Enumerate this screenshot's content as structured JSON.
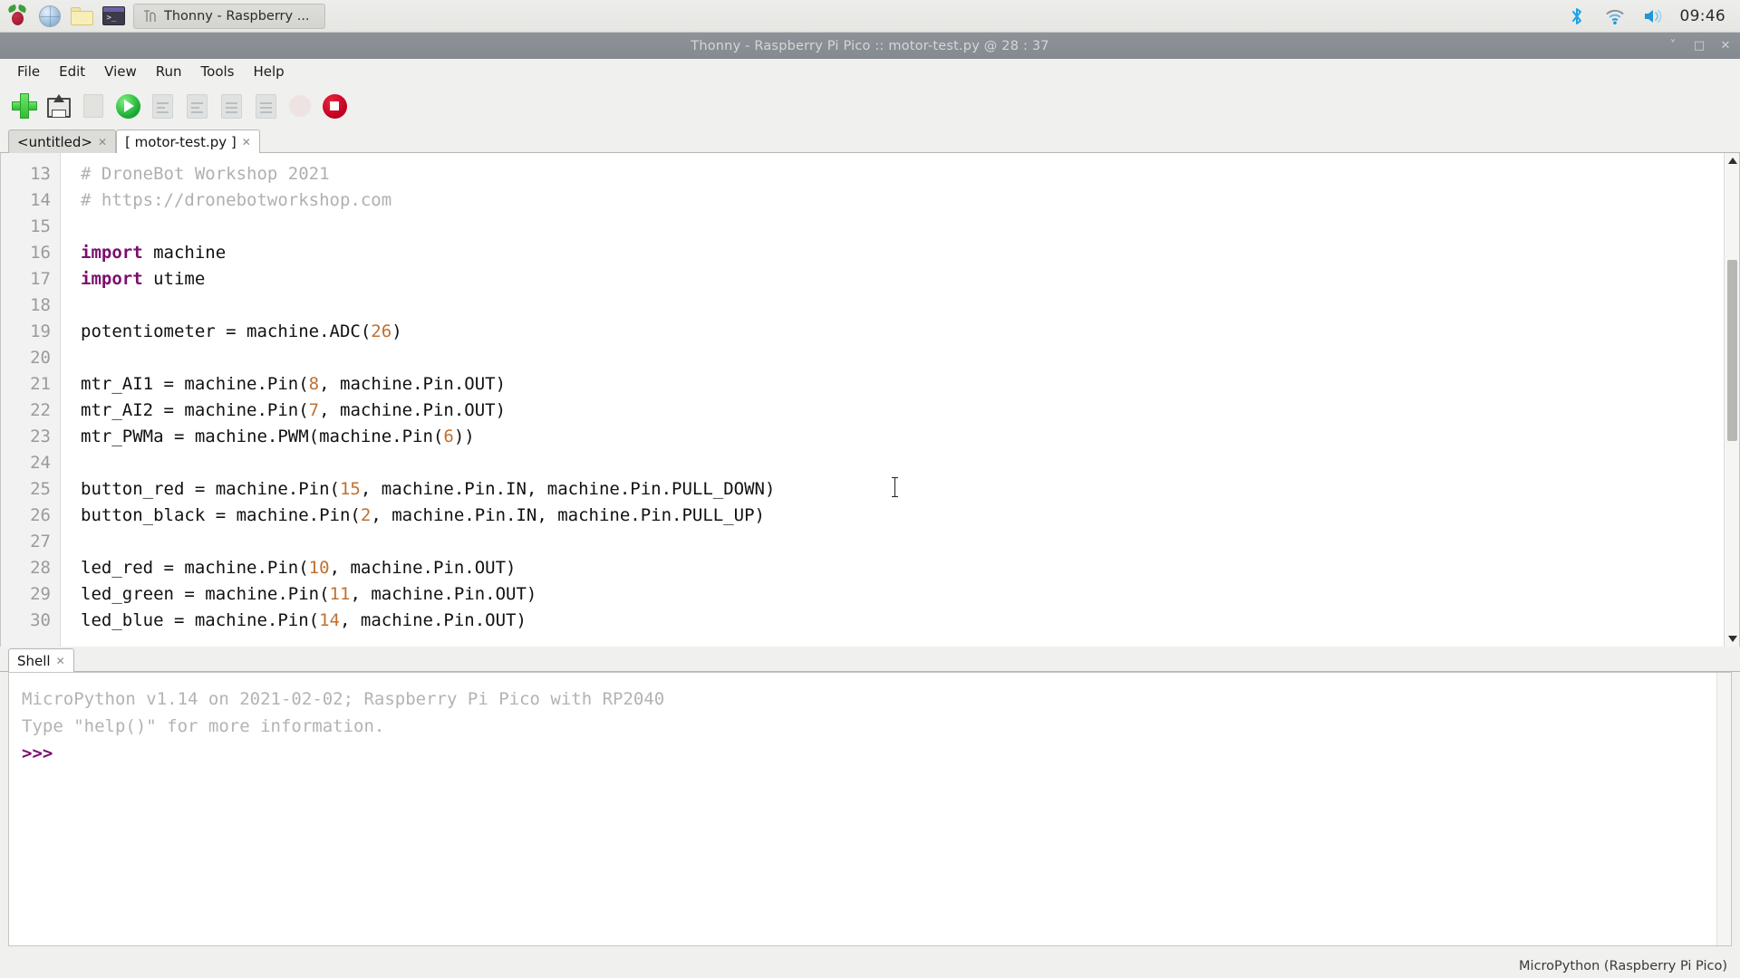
{
  "taskbar": {
    "launchers": [
      {
        "name": "raspberry-pi-menu",
        "label": "Raspberry Pi Menu"
      },
      {
        "name": "web-browser",
        "label": "Web Browser"
      },
      {
        "name": "file-manager",
        "label": "File Manager"
      },
      {
        "name": "terminal",
        "label": "Terminal"
      }
    ],
    "window_button": {
      "label": "Thonny - Raspberry ...",
      "icon": "thonny-icon"
    },
    "tray": {
      "bluetooth": "bluetooth-icon",
      "wifi": "wifi-icon",
      "volume": "volume-icon",
      "clock": "09:46"
    }
  },
  "window": {
    "title": "Thonny  -  Raspberry Pi Pico  ::  motor-test.py  @  28 : 37",
    "controls": {
      "minimize": "˅",
      "maximize": "□",
      "close": "✕"
    }
  },
  "menubar": {
    "items": [
      "File",
      "Edit",
      "View",
      "Run",
      "Tools",
      "Help"
    ]
  },
  "toolbar": {
    "buttons": [
      {
        "name": "new-file-button",
        "icon": "plus-icon",
        "enabled": true
      },
      {
        "name": "open-file-button",
        "icon": "load-disk-icon",
        "enabled": true
      },
      {
        "name": "save-file-button",
        "icon": "save-icon",
        "enabled": false
      },
      {
        "name": "run-button",
        "icon": "play-icon",
        "enabled": true
      },
      {
        "name": "debug-button",
        "icon": "debug-icon",
        "enabled": false
      },
      {
        "name": "step-over-button",
        "icon": "step-over-icon",
        "enabled": false
      },
      {
        "name": "step-into-button",
        "icon": "step-into-icon",
        "enabled": false
      },
      {
        "name": "step-out-button",
        "icon": "step-out-icon",
        "enabled": false
      },
      {
        "name": "resume-button",
        "icon": "resume-icon",
        "enabled": false
      },
      {
        "name": "stop-button",
        "icon": "stop-icon",
        "enabled": true
      }
    ]
  },
  "editor": {
    "tabs": [
      {
        "label": "<untitled>",
        "close": "✕",
        "active": false
      },
      {
        "label": "[ motor-test.py ]",
        "close": "✕",
        "active": true
      }
    ],
    "first_line_number": 13,
    "lines": [
      {
        "n": "13",
        "html": "<span class=\"cm\"># DroneBot Workshop 2021</span>"
      },
      {
        "n": "14",
        "html": "<span class=\"cm\"># https://dronebotworkshop.com</span>"
      },
      {
        "n": "15",
        "html": ""
      },
      {
        "n": "16",
        "html": "<span class=\"kw\">import</span> machine"
      },
      {
        "n": "17",
        "html": "<span class=\"kw\">import</span> utime"
      },
      {
        "n": "18",
        "html": ""
      },
      {
        "n": "19",
        "html": "potentiometer = machine.ADC(<span class=\"num\">26</span>)"
      },
      {
        "n": "20",
        "html": ""
      },
      {
        "n": "21",
        "html": "mtr_AI1 = machine.Pin(<span class=\"num\">8</span>, machine.Pin.OUT)"
      },
      {
        "n": "22",
        "html": "mtr_AI2 = machine.Pin(<span class=\"num\">7</span>, machine.Pin.OUT)"
      },
      {
        "n": "23",
        "html": "mtr_PWMa = machine.PWM(machine.Pin(<span class=\"num\">6</span>))"
      },
      {
        "n": "24",
        "html": ""
      },
      {
        "n": "25",
        "html": "button_red = machine.Pin(<span class=\"num\">15</span>, machine.Pin.IN, machine.Pin.PULL_DOWN)"
      },
      {
        "n": "26",
        "html": "button_black = machine.Pin(<span class=\"num\">2</span>, machine.Pin.IN, machine.Pin.PULL_UP)"
      },
      {
        "n": "27",
        "html": ""
      },
      {
        "n": "28",
        "html": "led_red = machine.Pin(<span class=\"num\">10</span>, machine.Pin.OUT)"
      },
      {
        "n": "29",
        "html": "led_green = machine.Pin(<span class=\"num\">11</span>, machine.Pin.OUT)"
      },
      {
        "n": "30",
        "html": "led_blue = machine.Pin(<span class=\"num\">14</span>, machine.Pin.OUT)"
      }
    ]
  },
  "shell": {
    "tab": {
      "label": "Shell",
      "close": "✕"
    },
    "lines": [
      {
        "html": "MicroPython v1.14 on 2021-02-02; Raspberry Pi Pico with RP2040"
      },
      {
        "html": "Type \"help()\" for more information."
      },
      {
        "html": "<span class=\"prompt\">&gt;&gt;&gt;</span>"
      }
    ]
  },
  "statusbar": {
    "interpreter": "MicroPython (Raspberry Pi Pico)"
  },
  "colors": {
    "accent_green": "#15a830",
    "accent_red": "#c00020",
    "keyword": "#7a0f6e",
    "number": "#c07030",
    "comment": "#b0b0b0",
    "titlebar": "#848a90"
  }
}
